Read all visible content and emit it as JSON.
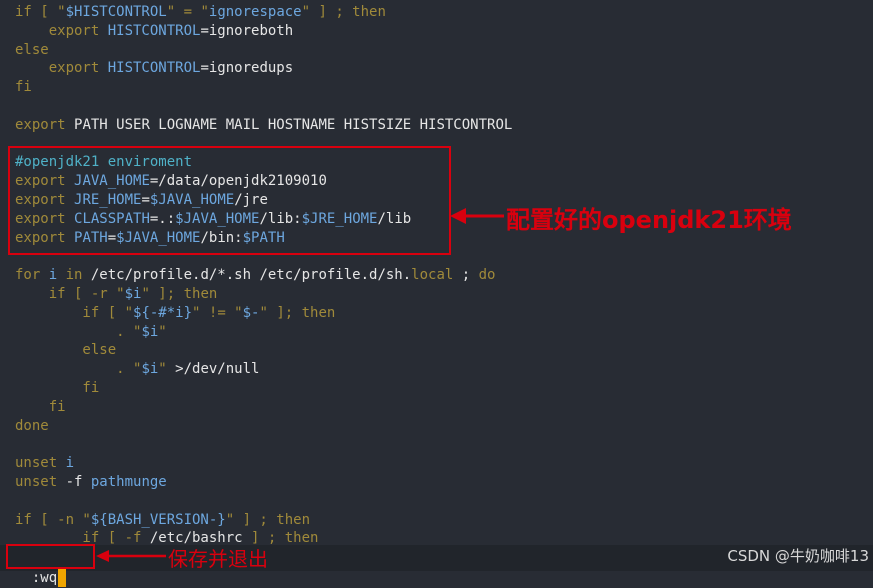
{
  "editor": {
    "lines": [
      [
        {
          "t": "if [ \"",
          "c": "keyword"
        },
        {
          "t": "$HISTCONTROL",
          "c": "var"
        },
        {
          "t": "\" = \"",
          "c": "keyword"
        },
        {
          "t": "ignorespace",
          "c": "string"
        },
        {
          "t": "\" ] ; then",
          "c": "keyword"
        }
      ],
      [
        {
          "t": "    export ",
          "c": "keyword"
        },
        {
          "t": "HISTCONTROL",
          "c": "var"
        },
        {
          "t": "=ignoreboth",
          "c": "plain"
        }
      ],
      [
        {
          "t": "else",
          "c": "keyword"
        }
      ],
      [
        {
          "t": "    export ",
          "c": "keyword"
        },
        {
          "t": "HISTCONTROL",
          "c": "var"
        },
        {
          "t": "=ignoredups",
          "c": "plain"
        }
      ],
      [
        {
          "t": "fi",
          "c": "keyword"
        }
      ],
      [],
      [
        {
          "t": "export ",
          "c": "keyword"
        },
        {
          "t": "PATH USER LOGNAME MAIL HOSTNAME HISTSIZE HISTCONTROL",
          "c": "plain"
        }
      ],
      [],
      [
        {
          "t": "#openjdk21 enviroment",
          "c": "comment"
        }
      ],
      [
        {
          "t": "export ",
          "c": "keyword"
        },
        {
          "t": "JAVA_HOME",
          "c": "var"
        },
        {
          "t": "=/data/openjdk2109010",
          "c": "plain"
        }
      ],
      [
        {
          "t": "export ",
          "c": "keyword"
        },
        {
          "t": "JRE_HOME",
          "c": "var"
        },
        {
          "t": "=",
          "c": "plain"
        },
        {
          "t": "$JAVA_HOME",
          "c": "var"
        },
        {
          "t": "/jre",
          "c": "plain"
        }
      ],
      [
        {
          "t": "export ",
          "c": "keyword"
        },
        {
          "t": "CLASSPATH",
          "c": "var"
        },
        {
          "t": "=.:",
          "c": "plain"
        },
        {
          "t": "$JAVA_HOME",
          "c": "var"
        },
        {
          "t": "/lib:",
          "c": "plain"
        },
        {
          "t": "$JRE_HOME",
          "c": "var"
        },
        {
          "t": "/lib",
          "c": "plain"
        }
      ],
      [
        {
          "t": "export ",
          "c": "keyword"
        },
        {
          "t": "PATH",
          "c": "var"
        },
        {
          "t": "=",
          "c": "plain"
        },
        {
          "t": "$JAVA_HOME",
          "c": "var"
        },
        {
          "t": "/bin:",
          "c": "plain"
        },
        {
          "t": "$PATH",
          "c": "var"
        }
      ],
      [],
      [
        {
          "t": "for ",
          "c": "keyword"
        },
        {
          "t": "i ",
          "c": "var"
        },
        {
          "t": "in ",
          "c": "keyword"
        },
        {
          "t": "/etc/profile.d/*.sh /etc/profile.d/sh.",
          "c": "plain"
        },
        {
          "t": "local",
          "c": "keyword"
        },
        {
          "t": " ; ",
          "c": "plain"
        },
        {
          "t": "do",
          "c": "keyword"
        }
      ],
      [
        {
          "t": "    if [ -r \"",
          "c": "keyword"
        },
        {
          "t": "$i",
          "c": "var"
        },
        {
          "t": "\" ]; then",
          "c": "keyword"
        }
      ],
      [
        {
          "t": "        if [ \"",
          "c": "keyword"
        },
        {
          "t": "${-#*i}",
          "c": "var"
        },
        {
          "t": "\" != \"",
          "c": "keyword"
        },
        {
          "t": "$-",
          "c": "var"
        },
        {
          "t": "\" ]; then",
          "c": "keyword"
        }
      ],
      [
        {
          "t": "            . \"",
          "c": "keyword"
        },
        {
          "t": "$i",
          "c": "var"
        },
        {
          "t": "\"",
          "c": "keyword"
        }
      ],
      [
        {
          "t": "        else",
          "c": "keyword"
        }
      ],
      [
        {
          "t": "            . \"",
          "c": "keyword"
        },
        {
          "t": "$i",
          "c": "var"
        },
        {
          "t": "\" ",
          "c": "keyword"
        },
        {
          "t": ">/dev/null",
          "c": "plain"
        }
      ],
      [
        {
          "t": "        fi",
          "c": "keyword"
        }
      ],
      [
        {
          "t": "    fi",
          "c": "keyword"
        }
      ],
      [
        {
          "t": "done",
          "c": "keyword"
        }
      ],
      [],
      [
        {
          "t": "unset ",
          "c": "keyword"
        },
        {
          "t": "i",
          "c": "var"
        }
      ],
      [
        {
          "t": "unset ",
          "c": "keyword"
        },
        {
          "t": "-f ",
          "c": "plain"
        },
        {
          "t": "pathmunge",
          "c": "var"
        }
      ],
      [],
      [
        {
          "t": "if [ -n \"",
          "c": "keyword"
        },
        {
          "t": "${BASH_VERSION-}",
          "c": "var"
        },
        {
          "t": "\" ] ; then",
          "c": "keyword"
        }
      ],
      [
        {
          "t": "        if [ -f ",
          "c": "keyword"
        },
        {
          "t": "/etc/bashrc",
          "c": "plain"
        },
        {
          "t": " ] ; then",
          "c": "keyword"
        }
      ]
    ]
  },
  "annotations": {
    "java_env_label": "配置好的openjdk21环境",
    "save_label": "保存并退出"
  },
  "command_line": {
    "text": ":wq"
  },
  "watermark": "CSDN @牛奶咖啡13",
  "colors": {
    "background": "#282c34",
    "keyword": "#a08a3a",
    "variable": "#6da7df",
    "comment": "#4fb2c8",
    "annotation_red": "#d9000e",
    "cursor": "#f0a500"
  }
}
